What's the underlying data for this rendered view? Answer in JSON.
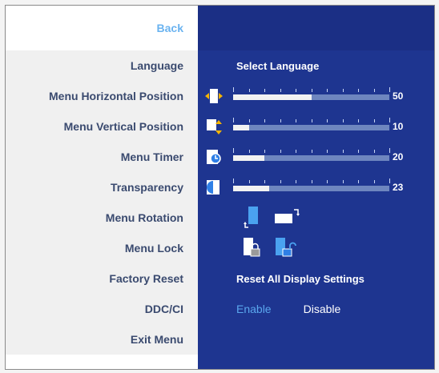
{
  "menu": {
    "back": "Back",
    "items": [
      {
        "label": "Language"
      },
      {
        "label": "Menu Horizontal Position"
      },
      {
        "label": "Menu Vertical Position"
      },
      {
        "label": "Menu Timer"
      },
      {
        "label": "Transparency"
      },
      {
        "label": "Menu Rotation"
      },
      {
        "label": "Menu Lock"
      },
      {
        "label": "Factory Reset"
      },
      {
        "label": "DDC/CI"
      },
      {
        "label": "Exit Menu"
      }
    ]
  },
  "settings": {
    "language": "Select Language",
    "horizontal_position": {
      "value": "50",
      "fraction": 0.5
    },
    "vertical_position": {
      "value": "10",
      "fraction": 0.1
    },
    "menu_timer": {
      "value": "20",
      "fraction": 0.2
    },
    "transparency": {
      "value": "23",
      "fraction": 0.23
    },
    "factory_reset": "Reset All Display Settings",
    "ddc_enable": "Enable",
    "ddc_disable": "Disable"
  },
  "icons": {
    "horizontal": "horizontal-position-icon",
    "vertical": "vertical-position-icon",
    "timer": "menu-timer-icon",
    "transparency": "transparency-icon",
    "rotate_portrait": "rotate-portrait-icon",
    "rotate_landscape": "rotate-landscape-icon",
    "lock": "menu-lock-icon",
    "unlock": "menu-unlock-icon"
  },
  "colors": {
    "panel": "#1e3590",
    "header": "#1b2f85",
    "back_text": "#6ab3f0",
    "label_text": "#3a4a6f",
    "highlight": "#5aa7ee"
  }
}
